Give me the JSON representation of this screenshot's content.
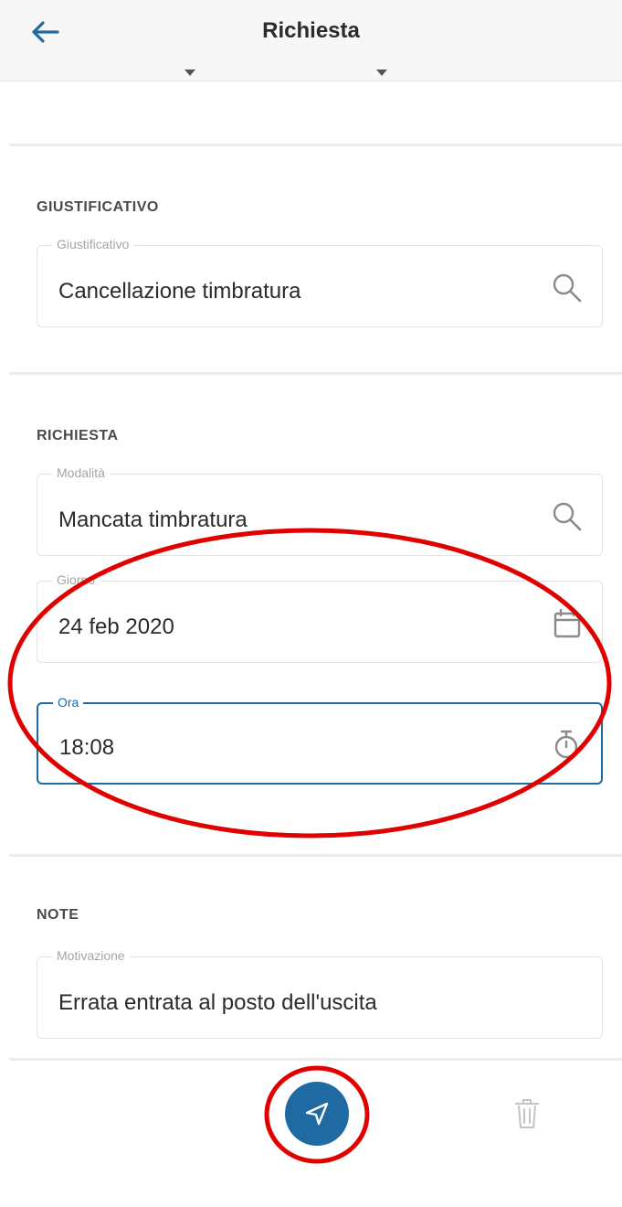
{
  "header": {
    "title": "Richiesta"
  },
  "sections": {
    "giustificativo": {
      "heading": "GIUSTIFICATIVO",
      "field_label": "Giustificativo",
      "field_value": "Cancellazione timbratura"
    },
    "richiesta": {
      "heading": "RICHIESTA",
      "modalita_label": "Modalità",
      "modalita_value": "Mancata timbratura",
      "giorno_label": "Giorno",
      "giorno_value": "24 feb 2020",
      "ora_label": "Ora",
      "ora_value": "18:08"
    },
    "note": {
      "heading": "NOTE",
      "field_label": "Motivazione",
      "field_value": "Errata entrata al posto dell'uscita"
    }
  },
  "icons": {
    "back": "arrow-left-icon",
    "search": "search-icon",
    "calendar": "calendar-icon",
    "clock": "stopwatch-icon",
    "send": "send-icon",
    "trash": "trash-icon"
  },
  "colors": {
    "accent": "#1f6aa3",
    "annotation": "#e00000",
    "muted": "#a5a5a5"
  }
}
